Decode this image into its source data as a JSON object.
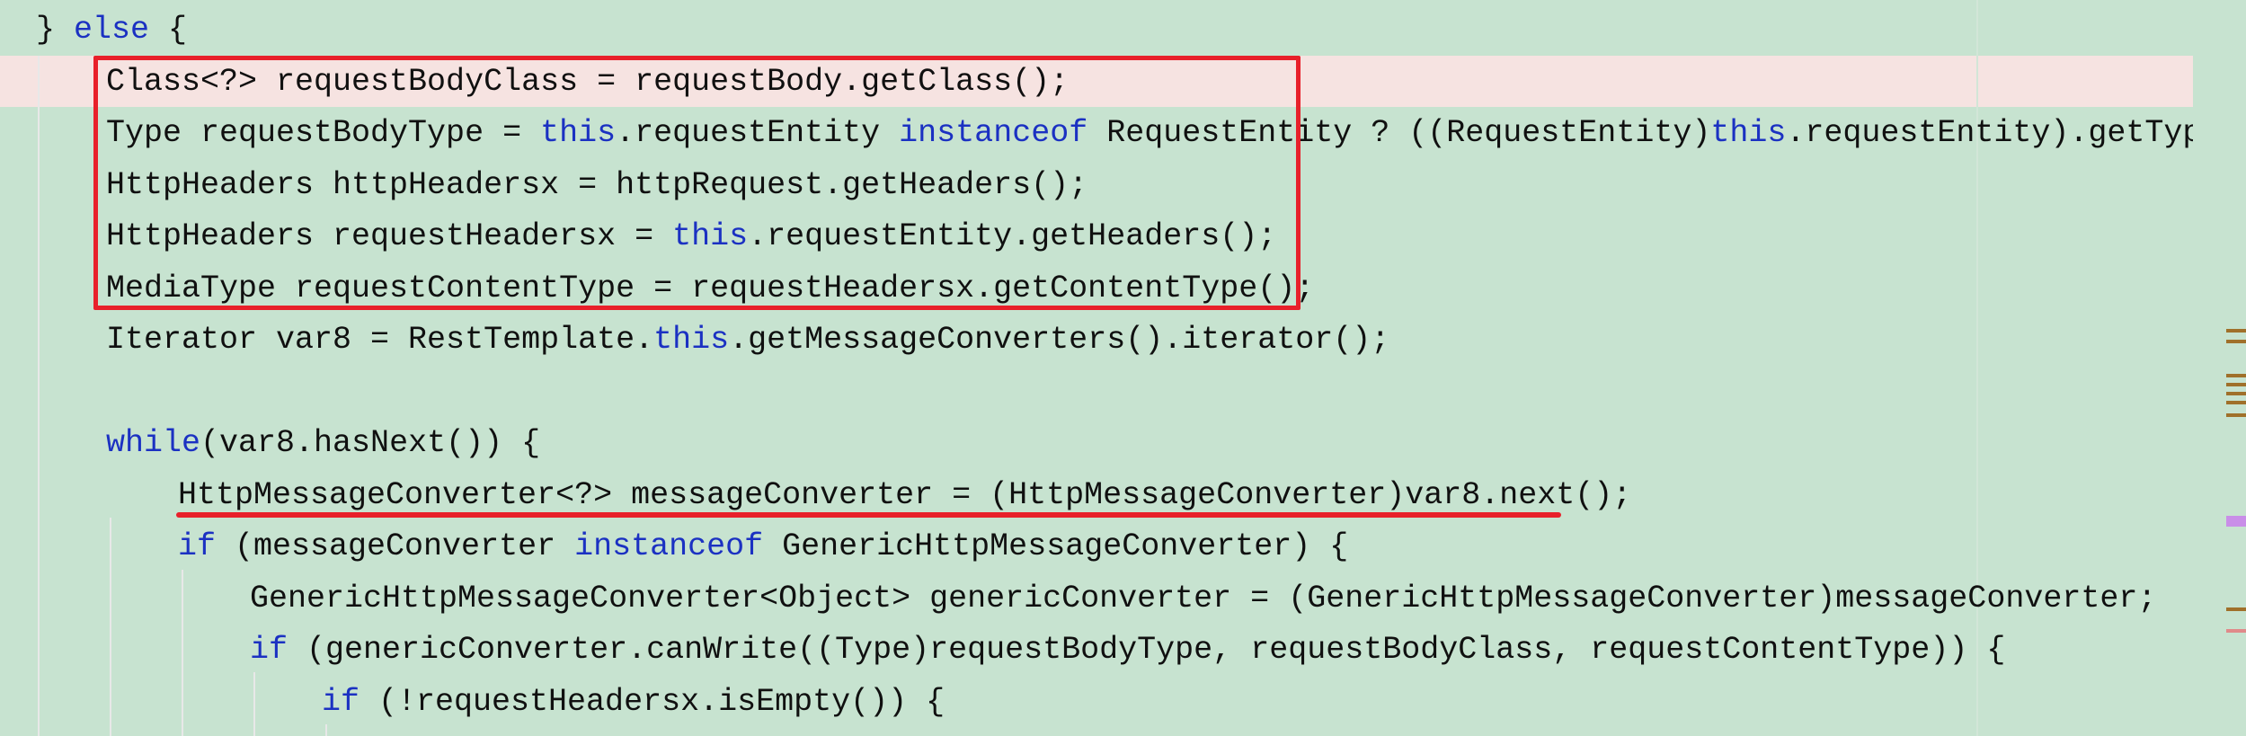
{
  "editor": {
    "lines": [
      {
        "tokens": [
          {
            "t": "} "
          },
          {
            "t": "else",
            "kw": true
          },
          {
            "t": " {"
          }
        ]
      },
      {
        "tokens": [
          {
            "t": "Class<?> requestBodyClass = requestBody.getClass();"
          }
        ]
      },
      {
        "tokens": [
          {
            "t": "Type requestBodyType = "
          },
          {
            "t": "this",
            "kw": true
          },
          {
            "t": ".requestEntity "
          },
          {
            "t": "instanceof",
            "kw": true
          },
          {
            "t": " RequestEntity ? ((RequestEntity)"
          },
          {
            "t": "this",
            "kw": true
          },
          {
            "t": ".requestEntity).getType() : re"
          }
        ]
      },
      {
        "tokens": [
          {
            "t": "HttpHeaders httpHeadersx = httpRequest.getHeaders();"
          }
        ]
      },
      {
        "tokens": [
          {
            "t": "HttpHeaders requestHeadersx = "
          },
          {
            "t": "this",
            "kw": true
          },
          {
            "t": ".requestEntity.getHeaders();"
          }
        ]
      },
      {
        "tokens": [
          {
            "t": "MediaType requestContentType = requestHeadersx.getContentType();"
          }
        ]
      },
      {
        "tokens": [
          {
            "t": "Iterator var8 = RestTemplate."
          },
          {
            "t": "this",
            "kw": true
          },
          {
            "t": ".getMessageConverters().iterator();"
          }
        ]
      },
      {
        "tokens": []
      },
      {
        "tokens": [
          {
            "t": "while",
            "kw": true
          },
          {
            "t": "(var8.hasNext()) {"
          }
        ]
      },
      {
        "tokens": [
          {
            "t": "HttpMessageConverter<?> messageConverter = (HttpMessageConverter)var8.next();"
          }
        ]
      },
      {
        "tokens": [
          {
            "t": "if",
            "kw": true
          },
          {
            "t": " (messageConverter "
          },
          {
            "t": "instanceof",
            "kw": true
          },
          {
            "t": " GenericHttpMessageConverter) {"
          }
        ]
      },
      {
        "tokens": [
          {
            "t": "GenericHttpMessageConverter<Object> genericConverter = (GenericHttpMessageConverter)messageConverter;"
          }
        ]
      },
      {
        "tokens": [
          {
            "t": "if",
            "kw": true
          },
          {
            "t": " (genericConverter.canWrite((Type)requestBodyType, requestBodyClass, requestContentType)) {"
          }
        ]
      },
      {
        "tokens": [
          {
            "t": "if",
            "kw": true
          },
          {
            "t": " (!requestHeadersx.isEmpty()) {"
          }
        ]
      }
    ]
  },
  "colors": {
    "background": "#c7e3d0",
    "keyword": "#1b31c2",
    "text": "#101010",
    "current_line": "#f6e3e1",
    "annotation": "#e8202a"
  },
  "scrollbar_markers": [
    {
      "color": "#a0702a"
    },
    {
      "color": "#a0702a"
    },
    {
      "color": "#a0702a"
    },
    {
      "color": "#a0702a"
    },
    {
      "color": "#a0702a"
    },
    {
      "color": "#a0702a"
    },
    {
      "color": "#a0702a"
    },
    {
      "color": "#c98ee8"
    },
    {
      "color": "#a0702a"
    },
    {
      "color": "#e08a8a"
    }
  ]
}
